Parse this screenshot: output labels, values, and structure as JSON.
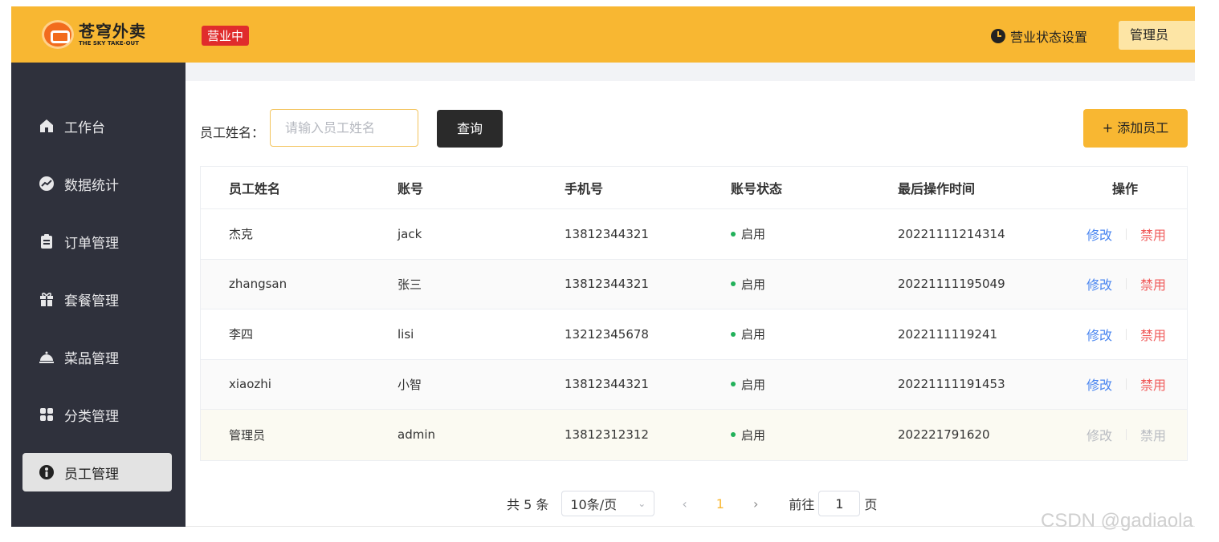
{
  "header": {
    "logo_cn": "苍穹外卖",
    "logo_en": "THE SKY TAKE-OUT",
    "status_badge": "营业中",
    "status_setting_label": "营业状态设置",
    "admin_label": "管理员"
  },
  "sidebar": {
    "items": [
      {
        "label": "工作台",
        "icon": "home-icon"
      },
      {
        "label": "数据统计",
        "icon": "chart-icon"
      },
      {
        "label": "订单管理",
        "icon": "clipboard-icon"
      },
      {
        "label": "套餐管理",
        "icon": "gift-icon"
      },
      {
        "label": "菜品管理",
        "icon": "dish-icon"
      },
      {
        "label": "分类管理",
        "icon": "grid-icon"
      },
      {
        "label": "员工管理",
        "icon": "employee-icon",
        "active": true
      }
    ]
  },
  "search": {
    "label": "员工姓名：",
    "placeholder": "请输入员工姓名",
    "value": "",
    "query_label": "查询"
  },
  "add_button_label": "+ 添加员工",
  "table": {
    "headers": [
      "员工姓名",
      "账号",
      "手机号",
      "账号状态",
      "最后操作时间",
      "操作"
    ],
    "rows": [
      {
        "name": "杰克",
        "account": "jack",
        "phone": "13812344321",
        "status": "启用",
        "time": "20221111214314",
        "edit": "修改",
        "disable": "禁用"
      },
      {
        "name": "zhangsan",
        "account": "张三",
        "phone": "13812344321",
        "status": "启用",
        "time": "20221111195049",
        "edit": "修改",
        "disable": "禁用"
      },
      {
        "name": "李四",
        "account": "lisi",
        "phone": "13212345678",
        "status": "启用",
        "time": "2022111119241",
        "edit": "修改",
        "disable": "禁用"
      },
      {
        "name": "xiaozhi",
        "account": "小智",
        "phone": "13812344321",
        "status": "启用",
        "time": "20221111191453",
        "edit": "修改",
        "disable": "禁用"
      },
      {
        "name": "管理员",
        "account": "admin",
        "phone": "13812312312",
        "status": "启用",
        "time": "202221791620",
        "edit": "修改",
        "disable": "禁用"
      }
    ]
  },
  "pagination": {
    "total_text": "共 5 条",
    "page_size": "10条/页",
    "prev": "‹",
    "current_page": "1",
    "next": "›",
    "goto_label": "前往",
    "goto_value": "1",
    "page_suffix": "页"
  },
  "watermark": "CSDN @gadiaola",
  "colors": {
    "brand_yellow": "#f8b732",
    "sidebar_bg": "#2f313c",
    "status_red": "#e02c2c",
    "edit_blue": "#4a86f0",
    "disable_red": "#f05b5b",
    "enabled_green": "#22b15a"
  }
}
